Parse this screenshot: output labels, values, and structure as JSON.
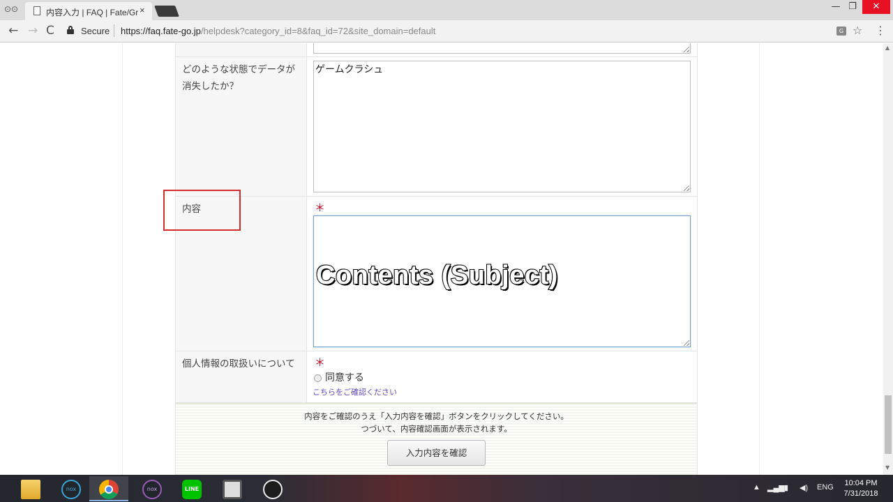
{
  "browser": {
    "tab_title": "内容入力 | FAQ | Fate/Gr",
    "tab_close": "×",
    "secure_label": "Secure",
    "url_host": "https://faq.fate-go.jp",
    "url_path": "/helpdesk?category_id=8&faq_id=72&site_domain=default",
    "window_min": "—",
    "window_max": "❐",
    "window_close": "✕",
    "nav_back": "←",
    "nav_forward": "→",
    "nav_reload": "C",
    "star": "☆",
    "menu": "⋮"
  },
  "form": {
    "data_loss_label": "どのような状態でデータが消失したか？",
    "data_loss_value": "ゲームクラシュ",
    "content_label": "内容",
    "content_value": "",
    "privacy_label": "個人情報の取扱いについて",
    "required_mark": "＊",
    "agree_label": "同意する",
    "confirm_link": "こちらをご確認ください",
    "note_line1": "内容をご確認のうえ「入力内容を確認」ボタンをクリックしてください。",
    "note_line2": "つづいて、内容確認画面が表示されます。",
    "confirm_button": "入力内容を確認"
  },
  "overlay": {
    "caption": "Contents (Subject)",
    "highlight_color": "#d42a2a"
  },
  "taskbar": {
    "apps": [
      "file-explorer",
      "nox",
      "chrome",
      "nox-multi",
      "line",
      "camera-app",
      "obs"
    ],
    "line_text": "LINE",
    "nox_text": "nox",
    "lang": "ENG",
    "time": "10:04 PM",
    "date": "7/31/2018"
  },
  "colors": {
    "required": "#d0021b",
    "link": "#5b4bbf",
    "focus_border": "#7ea3c9",
    "close_button": "#e81123"
  }
}
